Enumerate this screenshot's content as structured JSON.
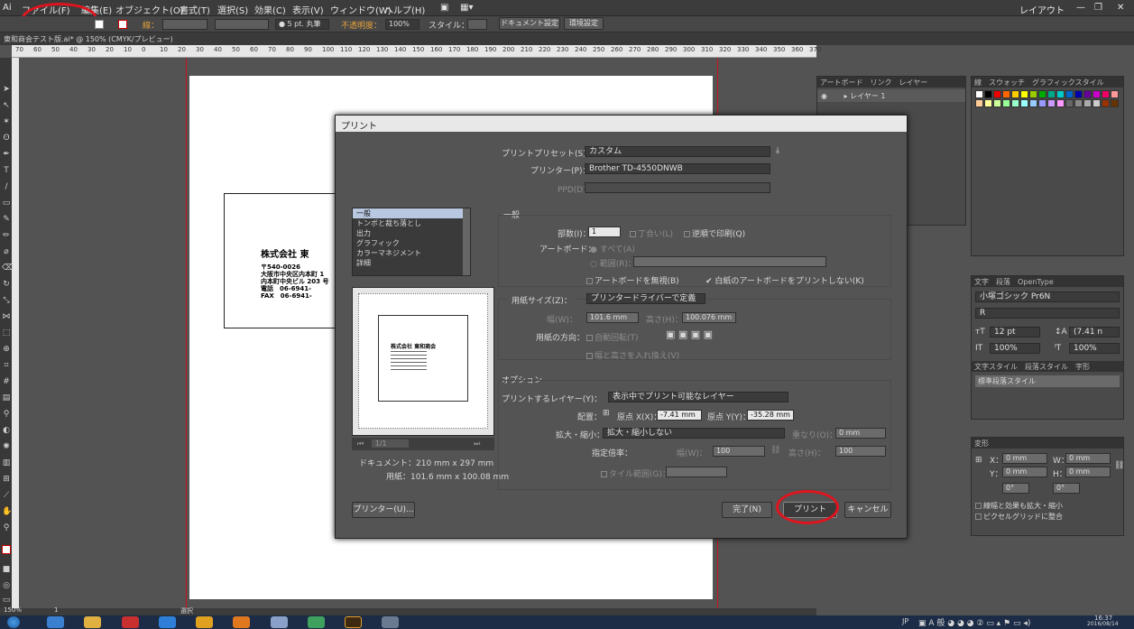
{
  "menu": {
    "items": [
      "ファイル(F)",
      "編集(E)",
      "オブジェクト(O)",
      "書式(T)",
      "選択(S)",
      "効果(C)",
      "表示(V)",
      "ウィンドウ(W)",
      "ヘルプ(H)"
    ],
    "workspace": "レイアウト",
    "window_controls": {
      "minimize": "—",
      "restore": "❐",
      "close": "✕"
    }
  },
  "control_bar": {
    "stroke_label": "線：",
    "brush": "● 5 pt. 丸筆",
    "opacity_label": "不透明度：",
    "opacity_value": "100%",
    "style_label": "スタイル：",
    "doc_setup": "ドキュメント設定",
    "prefs": "環境設定"
  },
  "document_tab": "東和商会テスト版.ai* @ 150% (CMYK/プレビュー)",
  "ruler_ticks": [
    "70",
    "60",
    "50",
    "40",
    "30",
    "20",
    "10",
    "0",
    "10",
    "20",
    "30",
    "40",
    "50",
    "60",
    "70",
    "80",
    "90",
    "100",
    "110",
    "120",
    "130",
    "140",
    "150",
    "160",
    "170",
    "180",
    "190",
    "200",
    "210",
    "220",
    "230",
    "240",
    "250",
    "260",
    "270",
    "280",
    "290",
    "300",
    "310",
    "320",
    "330",
    "340",
    "350",
    "360",
    "370"
  ],
  "business_card": {
    "company": "株式会社 東",
    "postal": "〒540-0026",
    "address1": "大阪市中央区内本町 1",
    "address2": "内本町中央ビル 203 号",
    "tel": "電話　06-6941-",
    "fax": "FAX　06-6941-"
  },
  "panels": {
    "layers_tabs": "アートボード　リンク　レイヤー",
    "layer_name": "レイヤー 1",
    "swatch_tabs": "線　スウォッチ　グラフィックスタイル",
    "char_tabs": "文字　段落　OpenType",
    "font": "小塚ゴシック Pr6N",
    "font_style": "R",
    "font_size": "12 pt",
    "leading": "(7.41 n",
    "scale_v": "100%",
    "scale_h": "100%",
    "style_tabs": "文字スタイル　段落スタイル　字形",
    "para_style": "標準段落スタイル",
    "transform_tab": "変形",
    "x_label": "X：",
    "x_val": "0 mm",
    "y_label": "Y：",
    "y_val": "0 mm",
    "w_label": "W：",
    "w_val": "0 mm",
    "h_label": "H：",
    "h_val": "0 mm",
    "angle": "0°",
    "shear": "0°",
    "scale_strokes": "線幅と効果も拡大・縮小",
    "pixel_grid": "ピクセルグリッドに整合"
  },
  "print_dialog": {
    "title": "プリント",
    "preset_label": "プリントプリセット(S)：",
    "preset_value": "カスタム",
    "printer_label": "プリンター(P)：",
    "printer_value": "Brother TD-4550DNWB",
    "ppd_label": "PPD(D)：",
    "categories": [
      "一般",
      "トンボと裁ち落とし",
      "出力",
      "グラフィック",
      "カラーマネジメント",
      "詳細"
    ],
    "general_header": "一般",
    "copies_label": "部数(I)：",
    "copies_value": "1",
    "collate": "丁合い(L)",
    "reverse": "逆順で印刷(Q)",
    "artboard_label": "アートボード：",
    "all": "すべて(A)",
    "range": "範囲(R)：",
    "ignore_artboards": "アートボードを無視(B)",
    "skip_blank": "✔ 白紙のアートボードをプリントしない(K)",
    "media_size_label": "用紙サイズ(Z)：",
    "media_size_value": "プリンタードライバーで定義",
    "width_label": "幅(W)：",
    "width_value": "101.6 mm",
    "height_label": "高さ(H)：",
    "height_value": "100.076 mm",
    "orientation_label": "用紙の方向：",
    "auto_rotate": "自動回転(T)",
    "transverse": "幅と高さを入れ換え(V)",
    "options_header": "オプション",
    "layers_label": "プリントするレイヤー(Y)：",
    "layers_value": "表示中でプリント可能なレイヤー",
    "placement_label": "配置：",
    "origin_x_label": "原点 X(X)：",
    "origin_x_value": "-7.41 mm",
    "origin_y_label": "原点 Y(Y)：",
    "origin_y_value": "-35.28 mm",
    "scaling_label": "拡大・縮小：",
    "scaling_value": "拡大・縮小しない",
    "overlap_label": "重なり(O)：",
    "overlap_value": "0 mm",
    "custom_scale_label": "指定倍率：",
    "scale_w_label": "幅(W)：",
    "scale_w_value": "100",
    "scale_h_label": "高さ(H)：",
    "scale_h_value": "100",
    "tile_range": "タイル範囲(G)：",
    "page_nav": "1/1",
    "doc_size": "ドキュメント：210 mm x 297 mm",
    "media_size": "用紙：101.6 mm x 100.08 mm",
    "preview_company": "株式会社 東和商会",
    "printer_button": "プリンター(U)...",
    "done_button": "完了(N)",
    "print_button": "プリント",
    "cancel_button": "キャンセル"
  },
  "status": {
    "zoom": "150%",
    "page": "1",
    "mode": "選択"
  },
  "taskbar": {
    "lang": "JP",
    "time": "16:37",
    "date": "2016/08/14"
  }
}
